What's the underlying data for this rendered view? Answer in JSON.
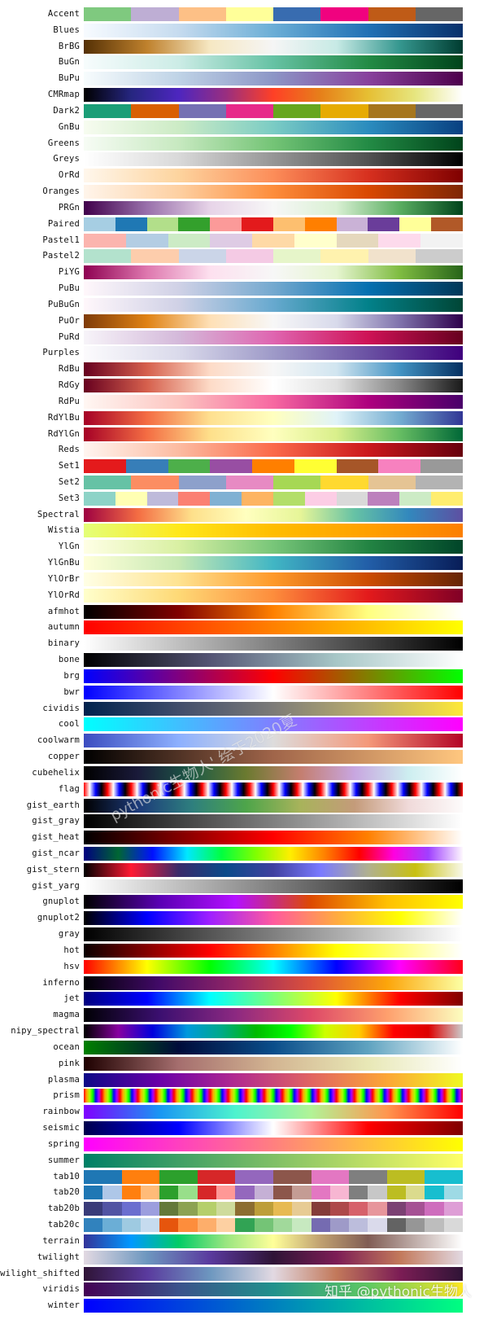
{
  "watermark": "pythonic生物人' 绘于2020夏",
  "source_mark": "知乎 @pythonic生物人",
  "chart_data": {
    "type": "colormap-table",
    "title": "",
    "rows": [
      {
        "name": "Accent",
        "kind": "discrete",
        "colors": [
          "#7fc97f",
          "#beaed4",
          "#fdc086",
          "#ffff99",
          "#386cb0",
          "#f0027f",
          "#bf5b17",
          "#666666"
        ]
      },
      {
        "name": "Blues",
        "kind": "gradient",
        "colors": [
          "#f7fbff",
          "#c6dbef",
          "#6baed6",
          "#2171b5",
          "#08306b"
        ]
      },
      {
        "name": "BrBG",
        "kind": "gradient",
        "colors": [
          "#543005",
          "#bf812d",
          "#f6e8c3",
          "#f5f5f5",
          "#c7eae5",
          "#35978f",
          "#003c30"
        ]
      },
      {
        "name": "BuGn",
        "kind": "gradient",
        "colors": [
          "#f7fcfd",
          "#ccece6",
          "#66c2a4",
          "#238b45",
          "#00441b"
        ]
      },
      {
        "name": "BuPu",
        "kind": "gradient",
        "colors": [
          "#f7fcfd",
          "#bfd3e6",
          "#8c96c6",
          "#88419d",
          "#4d004b"
        ]
      },
      {
        "name": "CMRmap",
        "kind": "gradient",
        "colors": [
          "#000000",
          "#262680",
          "#4d26bf",
          "#992e80",
          "#ff4026",
          "#e6801a",
          "#e6bf33",
          "#e6e680",
          "#ffffff"
        ]
      },
      {
        "name": "Dark2",
        "kind": "discrete",
        "colors": [
          "#1b9e77",
          "#d95f02",
          "#7570b3",
          "#e7298a",
          "#66a61e",
          "#e6ab02",
          "#a6761d",
          "#666666"
        ]
      },
      {
        "name": "GnBu",
        "kind": "gradient",
        "colors": [
          "#f7fcf0",
          "#ccebc5",
          "#7bccc4",
          "#2b8cbe",
          "#084081"
        ]
      },
      {
        "name": "Greens",
        "kind": "gradient",
        "colors": [
          "#f7fcf5",
          "#c7e9c0",
          "#74c476",
          "#238b45",
          "#00441b"
        ]
      },
      {
        "name": "Greys",
        "kind": "gradient",
        "colors": [
          "#ffffff",
          "#d9d9d9",
          "#969696",
          "#525252",
          "#000000"
        ]
      },
      {
        "name": "OrRd",
        "kind": "gradient",
        "colors": [
          "#fff7ec",
          "#fdd49e",
          "#fc8d59",
          "#d7301f",
          "#7f0000"
        ]
      },
      {
        "name": "Oranges",
        "kind": "gradient",
        "colors": [
          "#fff5eb",
          "#fdd0a2",
          "#fd8d3c",
          "#d94801",
          "#7f2704"
        ]
      },
      {
        "name": "PRGn",
        "kind": "gradient",
        "colors": [
          "#40004b",
          "#9970ab",
          "#e7d4e8",
          "#f7f7f7",
          "#d9f0d3",
          "#5aae61",
          "#00441b"
        ]
      },
      {
        "name": "Paired",
        "kind": "discrete",
        "colors": [
          "#a6cee3",
          "#1f78b4",
          "#b2df8a",
          "#33a02c",
          "#fb9a99",
          "#e31a1c",
          "#fdbf6f",
          "#ff7f00",
          "#cab2d6",
          "#6a3d9a",
          "#ffff99",
          "#b15928"
        ]
      },
      {
        "name": "Pastel1",
        "kind": "discrete",
        "colors": [
          "#fbb4ae",
          "#b3cde3",
          "#ccebc5",
          "#decbe4",
          "#fed9a6",
          "#ffffcc",
          "#e5d8bd",
          "#fddaec",
          "#f2f2f2"
        ]
      },
      {
        "name": "Pastel2",
        "kind": "discrete",
        "colors": [
          "#b3e2cd",
          "#fdcdac",
          "#cbd5e8",
          "#f4cae4",
          "#e6f5c9",
          "#fff2ae",
          "#f1e2cc",
          "#cccccc"
        ]
      },
      {
        "name": "PiYG",
        "kind": "gradient",
        "colors": [
          "#8e0152",
          "#de77ae",
          "#fde0ef",
          "#f7f7f7",
          "#e6f5d0",
          "#7fbc41",
          "#276419"
        ]
      },
      {
        "name": "PuBu",
        "kind": "gradient",
        "colors": [
          "#fff7fb",
          "#d0d1e6",
          "#74a9cf",
          "#0570b0",
          "#023858"
        ]
      },
      {
        "name": "PuBuGn",
        "kind": "gradient",
        "colors": [
          "#fff7fb",
          "#d0d1e6",
          "#67a9cf",
          "#02818a",
          "#014636"
        ]
      },
      {
        "name": "PuOr",
        "kind": "gradient",
        "colors": [
          "#7f3b08",
          "#e08214",
          "#fee0b6",
          "#f7f7f7",
          "#d8daeb",
          "#8073ac",
          "#2d004b"
        ]
      },
      {
        "name": "PuRd",
        "kind": "gradient",
        "colors": [
          "#f7f4f9",
          "#d4b9da",
          "#df65b0",
          "#ce1256",
          "#67001f"
        ]
      },
      {
        "name": "Purples",
        "kind": "gradient",
        "colors": [
          "#fcfbfd",
          "#dadaeb",
          "#9e9ac8",
          "#6a51a3",
          "#3f007d"
        ]
      },
      {
        "name": "RdBu",
        "kind": "gradient",
        "colors": [
          "#67001f",
          "#d6604d",
          "#fddbc7",
          "#f7f7f7",
          "#d1e5f0",
          "#4393c3",
          "#053061"
        ]
      },
      {
        "name": "RdGy",
        "kind": "gradient",
        "colors": [
          "#67001f",
          "#d6604d",
          "#fddbc7",
          "#ffffff",
          "#e0e0e0",
          "#878787",
          "#1a1a1a"
        ]
      },
      {
        "name": "RdPu",
        "kind": "gradient",
        "colors": [
          "#fff7f3",
          "#fcc5c0",
          "#f768a1",
          "#ae017e",
          "#49006a"
        ]
      },
      {
        "name": "RdYlBu",
        "kind": "gradient",
        "colors": [
          "#a50026",
          "#f46d43",
          "#fee090",
          "#ffffbf",
          "#e0f3f8",
          "#74add1",
          "#313695"
        ]
      },
      {
        "name": "RdYlGn",
        "kind": "gradient",
        "colors": [
          "#a50026",
          "#f46d43",
          "#fee08b",
          "#ffffbf",
          "#d9ef8b",
          "#66bd63",
          "#006837"
        ]
      },
      {
        "name": "Reds",
        "kind": "gradient",
        "colors": [
          "#fff5f0",
          "#fcbba1",
          "#fb6a4a",
          "#cb181d",
          "#67000d"
        ]
      },
      {
        "name": "Set1",
        "kind": "discrete",
        "colors": [
          "#e41a1c",
          "#377eb8",
          "#4daf4a",
          "#984ea3",
          "#ff7f00",
          "#ffff33",
          "#a65628",
          "#f781bf",
          "#999999"
        ]
      },
      {
        "name": "Set2",
        "kind": "discrete",
        "colors": [
          "#66c2a5",
          "#fc8d62",
          "#8da0cb",
          "#e78ac3",
          "#a6d854",
          "#ffd92f",
          "#e5c494",
          "#b3b3b3"
        ]
      },
      {
        "name": "Set3",
        "kind": "discrete",
        "colors": [
          "#8dd3c7",
          "#ffffb3",
          "#bebada",
          "#fb8072",
          "#80b1d3",
          "#fdb462",
          "#b3de69",
          "#fccde5",
          "#d9d9d9",
          "#bc80bd",
          "#ccebc5",
          "#ffed6f"
        ]
      },
      {
        "name": "Spectral",
        "kind": "gradient",
        "colors": [
          "#9e0142",
          "#f46d43",
          "#fee08b",
          "#ffffbf",
          "#e6f598",
          "#66c2a5",
          "#3288bd",
          "#5e4fa2"
        ]
      },
      {
        "name": "Wistia",
        "kind": "gradient",
        "colors": [
          "#e4ff7a",
          "#ffe81a",
          "#ffbd00",
          "#ffa000",
          "#fc7f00"
        ]
      },
      {
        "name": "YlGn",
        "kind": "gradient",
        "colors": [
          "#ffffe5",
          "#d9f0a3",
          "#78c679",
          "#238443",
          "#004529"
        ]
      },
      {
        "name": "YlGnBu",
        "kind": "gradient",
        "colors": [
          "#ffffd9",
          "#c7e9b4",
          "#41b6c4",
          "#225ea8",
          "#081d58"
        ]
      },
      {
        "name": "YlOrBr",
        "kind": "gradient",
        "colors": [
          "#ffffe5",
          "#fee391",
          "#fe9929",
          "#cc4c02",
          "#662506"
        ]
      },
      {
        "name": "YlOrRd",
        "kind": "gradient",
        "colors": [
          "#ffffcc",
          "#fed976",
          "#fd8d3c",
          "#e31a1c",
          "#800026"
        ]
      },
      {
        "name": "afmhot",
        "kind": "gradient",
        "colors": [
          "#000000",
          "#800000",
          "#ff8000",
          "#ffff80",
          "#ffffff"
        ]
      },
      {
        "name": "autumn",
        "kind": "gradient",
        "colors": [
          "#ff0000",
          "#ff8000",
          "#ffff00"
        ]
      },
      {
        "name": "binary",
        "kind": "gradient",
        "colors": [
          "#ffffff",
          "#000000"
        ]
      },
      {
        "name": "bone",
        "kind": "gradient",
        "colors": [
          "#000000",
          "#545474",
          "#a7c7c7",
          "#ffffff"
        ]
      },
      {
        "name": "brg",
        "kind": "gradient",
        "colors": [
          "#0000ff",
          "#ff0000",
          "#00ff00"
        ]
      },
      {
        "name": "bwr",
        "kind": "gradient",
        "colors": [
          "#0000ff",
          "#ffffff",
          "#ff0000"
        ]
      },
      {
        "name": "cividis",
        "kind": "gradient",
        "colors": [
          "#00224e",
          "#414d6b",
          "#7c7b78",
          "#bcaf6f",
          "#fee838"
        ]
      },
      {
        "name": "cool",
        "kind": "gradient",
        "colors": [
          "#00ffff",
          "#ff00ff"
        ]
      },
      {
        "name": "coolwarm",
        "kind": "gradient",
        "colors": [
          "#3b4cc0",
          "#8db0fe",
          "#dddcdc",
          "#f4987a",
          "#b40426"
        ]
      },
      {
        "name": "copper",
        "kind": "gradient",
        "colors": [
          "#000000",
          "#a0654a",
          "#ffc77f"
        ]
      },
      {
        "name": "cubehelix",
        "kind": "gradient",
        "colors": [
          "#000000",
          "#1a1a3a",
          "#1d5a45",
          "#6b7a30",
          "#c47e6f",
          "#c8a6e0",
          "#cdeef0",
          "#ffffff"
        ]
      },
      {
        "name": "flag",
        "kind": "flag",
        "colors": [
          "#ff0000",
          "#ffffff",
          "#0000ff",
          "#000000"
        ],
        "cycles": 16
      },
      {
        "name": "gist_earth",
        "kind": "gradient",
        "colors": [
          "#000000",
          "#1c3a7a",
          "#2e7f7e",
          "#4ea54a",
          "#a8b35b",
          "#c49b7a",
          "#f0dada",
          "#fdfbfb"
        ]
      },
      {
        "name": "gist_gray",
        "kind": "gradient",
        "colors": [
          "#000000",
          "#ffffff"
        ]
      },
      {
        "name": "gist_heat",
        "kind": "gradient",
        "colors": [
          "#000000",
          "#800000",
          "#ff0000",
          "#ff8000",
          "#ffffff"
        ]
      },
      {
        "name": "gist_ncar",
        "kind": "gradient",
        "colors": [
          "#000080",
          "#006633",
          "#0010ff",
          "#00e8ff",
          "#00ff40",
          "#80ff00",
          "#ffee00",
          "#ff8000",
          "#ff0000",
          "#ff00e0",
          "#a040ff",
          "#fef8fe"
        ]
      },
      {
        "name": "gist_stern",
        "kind": "gradient",
        "colors": [
          "#000000",
          "#ff1a33",
          "#3a2a6a",
          "#0a4a8a",
          "#4040a0",
          "#7a7aff",
          "#b0b090",
          "#c8c010",
          "#f8f8e8"
        ]
      },
      {
        "name": "gist_yarg",
        "kind": "gradient",
        "colors": [
          "#ffffff",
          "#000000"
        ]
      },
      {
        "name": "gnuplot",
        "kind": "gradient",
        "colors": [
          "#000000",
          "#5a00b4",
          "#b410ff",
          "#dd4a00",
          "#ffc000",
          "#ffff00"
        ]
      },
      {
        "name": "gnuplot2",
        "kind": "gradient",
        "colors": [
          "#000000",
          "#0000ff",
          "#a020ff",
          "#ff5a9e",
          "#ffaa40",
          "#ffff00",
          "#ffffff"
        ]
      },
      {
        "name": "gray",
        "kind": "gradient",
        "colors": [
          "#000000",
          "#ffffff"
        ]
      },
      {
        "name": "hot",
        "kind": "gradient",
        "colors": [
          "#0b0000",
          "#ff0000",
          "#ffff00",
          "#ffffff"
        ]
      },
      {
        "name": "hsv",
        "kind": "gradient",
        "colors": [
          "#ff0000",
          "#ffff00",
          "#00ff00",
          "#00ffff",
          "#0000ff",
          "#ff00ff",
          "#ff0018"
        ]
      },
      {
        "name": "inferno",
        "kind": "gradient",
        "colors": [
          "#000004",
          "#420a68",
          "#932667",
          "#dd513a",
          "#fca50a",
          "#fcffa4"
        ]
      },
      {
        "name": "jet",
        "kind": "gradient",
        "colors": [
          "#000080",
          "#0000ff",
          "#00ffff",
          "#7dff7a",
          "#ffff00",
          "#ff0000",
          "#800000"
        ]
      },
      {
        "name": "magma",
        "kind": "gradient",
        "colors": [
          "#000004",
          "#3b0f70",
          "#8c2981",
          "#de4968",
          "#fe9f6d",
          "#fcfdbf"
        ]
      },
      {
        "name": "nipy_spectral",
        "kind": "gradient",
        "colors": [
          "#000000",
          "#8800a0",
          "#0000dd",
          "#0099dd",
          "#00aa88",
          "#00bb00",
          "#00ff00",
          "#ccff00",
          "#ffcc00",
          "#ff0000",
          "#dd0000",
          "#cccccc"
        ]
      },
      {
        "name": "ocean",
        "kind": "gradient",
        "colors": [
          "#008000",
          "#000b3a",
          "#0a4d8a",
          "#5fa3c0",
          "#ffffff"
        ]
      },
      {
        "name": "pink",
        "kind": "gradient",
        "colors": [
          "#1e0000",
          "#a56e6e",
          "#d3b592",
          "#e8e8b6",
          "#ffffff"
        ]
      },
      {
        "name": "plasma",
        "kind": "gradient",
        "colors": [
          "#0d0887",
          "#6a00a8",
          "#b12a90",
          "#e16462",
          "#fca636",
          "#f0f921"
        ]
      },
      {
        "name": "prism",
        "kind": "prism",
        "colors": [
          "#ff0000",
          "#ffaa00",
          "#aaff00",
          "#00ff00",
          "#0000ff",
          "#aa00ff"
        ],
        "cycles": 21
      },
      {
        "name": "rainbow",
        "kind": "gradient",
        "colors": [
          "#8000ff",
          "#1996f3",
          "#4df3ce",
          "#b2f396",
          "#ff964f",
          "#ff0000"
        ]
      },
      {
        "name": "seismic",
        "kind": "gradient",
        "colors": [
          "#00004c",
          "#0000ff",
          "#ffffff",
          "#ff0000",
          "#800000"
        ]
      },
      {
        "name": "spring",
        "kind": "gradient",
        "colors": [
          "#ff00ff",
          "#ffff00"
        ]
      },
      {
        "name": "summer",
        "kind": "gradient",
        "colors": [
          "#008066",
          "#ffff66"
        ]
      },
      {
        "name": "tab10",
        "kind": "discrete",
        "colors": [
          "#1f77b4",
          "#ff7f0e",
          "#2ca02c",
          "#d62728",
          "#9467bd",
          "#8c564b",
          "#e377c2",
          "#7f7f7f",
          "#bcbd22",
          "#17becf"
        ]
      },
      {
        "name": "tab20",
        "kind": "discrete",
        "colors": [
          "#1f77b4",
          "#aec7e8",
          "#ff7f0e",
          "#ffbb78",
          "#2ca02c",
          "#98df8a",
          "#d62728",
          "#ff9896",
          "#9467bd",
          "#c5b0d5",
          "#8c564b",
          "#c49c94",
          "#e377c2",
          "#f7b6d2",
          "#7f7f7f",
          "#c7c7c7",
          "#bcbd22",
          "#dbdb8d",
          "#17becf",
          "#9edae5"
        ]
      },
      {
        "name": "tab20b",
        "kind": "discrete",
        "colors": [
          "#393b79",
          "#5254a3",
          "#6b6ecf",
          "#9c9ede",
          "#637939",
          "#8ca252",
          "#b5cf6b",
          "#cedb9c",
          "#8c6d31",
          "#bd9e39",
          "#e7ba52",
          "#e7cb94",
          "#843c39",
          "#ad494a",
          "#d6616b",
          "#e7969c",
          "#7b4173",
          "#a55194",
          "#ce6dbd",
          "#de9ed6"
        ]
      },
      {
        "name": "tab20c",
        "kind": "discrete",
        "colors": [
          "#3182bd",
          "#6baed6",
          "#9ecae1",
          "#c6dbef",
          "#e6550d",
          "#fd8d3c",
          "#fdae6b",
          "#fdd0a2",
          "#31a354",
          "#74c476",
          "#a1d99b",
          "#c7e9c0",
          "#756bb1",
          "#9e9ac8",
          "#bcbddc",
          "#dadaeb",
          "#636363",
          "#969696",
          "#bdbdbd",
          "#d9d9d9"
        ]
      },
      {
        "name": "terrain",
        "kind": "gradient",
        "colors": [
          "#333399",
          "#0099ff",
          "#00cc66",
          "#99e680",
          "#ffff99",
          "#c0a070",
          "#805c54",
          "#c0aeaa",
          "#ffffff"
        ]
      },
      {
        "name": "twilight",
        "kind": "gradient",
        "colors": [
          "#e2d9e2",
          "#6d97bf",
          "#5a3a9e",
          "#2f1436",
          "#7c1d55",
          "#c2785a",
          "#e2d9e2"
        ]
      },
      {
        "name": "twilight_shifted",
        "kind": "gradient",
        "colors": [
          "#2f1436",
          "#5a3a9e",
          "#6d97bf",
          "#e2d9e2",
          "#c2785a",
          "#7c1d55",
          "#2f1436"
        ]
      },
      {
        "name": "viridis",
        "kind": "gradient",
        "colors": [
          "#440154",
          "#3b528b",
          "#21918c",
          "#5ec962",
          "#fde725"
        ]
      },
      {
        "name": "winter",
        "kind": "gradient",
        "colors": [
          "#0000ff",
          "#00ff80"
        ]
      }
    ]
  }
}
